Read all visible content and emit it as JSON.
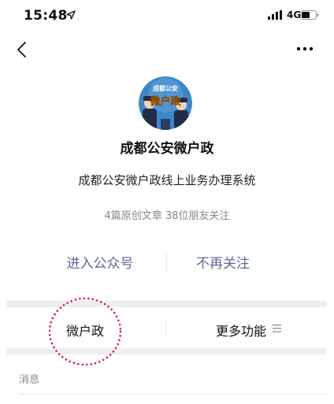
{
  "status_bar": {
    "time": "15:48",
    "network": "4G",
    "location_icon": "location-arrow-icon",
    "signal_icon": "signal-bars-icon",
    "battery_icon": "battery-icon"
  },
  "nav": {
    "back_icon": "chevron-left-icon",
    "more_icon": "ellipsis-icon"
  },
  "profile": {
    "avatar_text_top": "成都公安",
    "avatar_text_main": "微户政",
    "name": "成都公安微户政",
    "description": "成都公安微户政线上业务办理系统",
    "stats": "4篇原创文章  38位朋友关注"
  },
  "actions": {
    "enter_label": "进入公众号",
    "unfollow_label": "不再关注"
  },
  "menu": {
    "items": [
      {
        "label": "微户政"
      },
      {
        "label": "更多功能"
      }
    ],
    "more_icon": "menu-lines-icon"
  },
  "messages": {
    "label": "消息"
  },
  "colors": {
    "link": "#576b95",
    "annotation": "#e0203a",
    "separator": "#efefef",
    "avatar_bg": "#3f86c9"
  }
}
